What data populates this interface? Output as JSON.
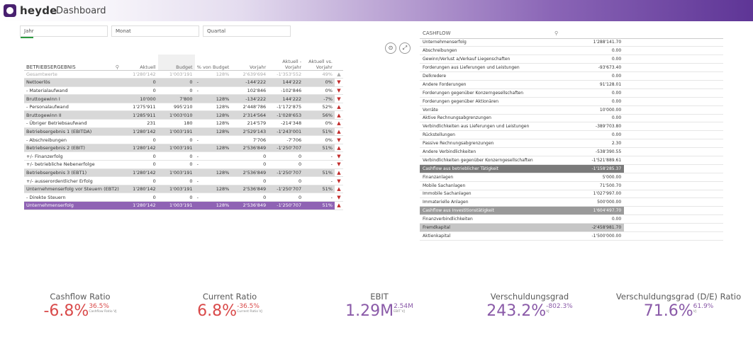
{
  "app": {
    "logo_text": "heyde",
    "title": "Dashboard"
  },
  "filters": [
    {
      "label": "Jahr"
    },
    {
      "label": "Monat"
    },
    {
      "label": "Quartal"
    }
  ],
  "left_table": {
    "columns": [
      "BETRIEBSERGEBNIS",
      "Aktuell",
      "Budget",
      "% von Budget",
      "Vorjahr",
      "Aktuell - Vorjahr",
      "Aktuell vs. Vorjahr"
    ],
    "total": {
      "label": "Gesamtwerte",
      "aktuell": "1'280'142",
      "budget": "1'003'191",
      "pct": "128%",
      "vorjahr": "2'639'694",
      "diff": "-1'353'552",
      "vs": "49%",
      "ind": "▲"
    },
    "rows": [
      {
        "label": "Nettoerlös",
        "aktuell": "0",
        "budget": "0",
        "pct": "-",
        "vorjahr": "-144'222",
        "diff": "144'222",
        "vs": "0%",
        "ind": "▼",
        "hl": true
      },
      {
        "label": "- Materialaufwand",
        "aktuell": "0",
        "budget": "0",
        "pct": "-",
        "vorjahr": "102'846",
        "diff": "-102'846",
        "vs": "0%",
        "ind": "▼",
        "hl": false
      },
      {
        "label": "Bruttogewinn I",
        "aktuell": "10'000",
        "budget": "7'800",
        "pct": "128%",
        "vorjahr": "-134'222",
        "diff": "144'222",
        "vs": "-7%",
        "ind": "▼",
        "hl": true
      },
      {
        "label": "- Personalaufwand",
        "aktuell": "1'275'911",
        "budget": "995'210",
        "pct": "128%",
        "vorjahr": "2'448'786",
        "diff": "-1'172'875",
        "vs": "52%",
        "ind": "▲",
        "hl": false
      },
      {
        "label": "Bruttogewinn II",
        "aktuell": "1'285'911",
        "budget": "1'003'010",
        "pct": "128%",
        "vorjahr": "2'314'564",
        "diff": "-1'028'653",
        "vs": "56%",
        "ind": "▲",
        "hl": true
      },
      {
        "label": "- Übriger Betriebsaufwand",
        "aktuell": "231",
        "budget": "180",
        "pct": "128%",
        "vorjahr": "214'579",
        "diff": "-214'348",
        "vs": "0%",
        "ind": "▲",
        "hl": false
      },
      {
        "label": "Betriebsergebnis 1 (EBITDA)",
        "aktuell": "1'280'142",
        "budget": "1'003'191",
        "pct": "128%",
        "vorjahr": "2'529'143",
        "diff": "-1'243'001",
        "vs": "51%",
        "ind": "▲",
        "hl": true
      },
      {
        "label": "- Abschreibungen",
        "aktuell": "0",
        "budget": "0",
        "pct": "-",
        "vorjahr": "7'706",
        "diff": "-7'706",
        "vs": "0%",
        "ind": "▼",
        "hl": false
      },
      {
        "label": "Betriebsergebnis 2 (EBIT)",
        "aktuell": "1'280'142",
        "budget": "1'003'191",
        "pct": "128%",
        "vorjahr": "2'536'849",
        "diff": "-1'250'707",
        "vs": "51%",
        "ind": "▲",
        "hl": true
      },
      {
        "label": "+/- Finanzerfolg",
        "aktuell": "0",
        "budget": "0",
        "pct": "-",
        "vorjahr": "0",
        "diff": "0",
        "vs": "-",
        "ind": "▼",
        "hl": false
      },
      {
        "label": "+/- betriebliche Nebenerfolge",
        "aktuell": "0",
        "budget": "0",
        "pct": "-",
        "vorjahr": "0",
        "diff": "0",
        "vs": "-",
        "ind": "▼",
        "hl": false
      },
      {
        "label": "Betriebsergebnis 3 (EBT1)",
        "aktuell": "1'280'142",
        "budget": "1'003'191",
        "pct": "128%",
        "vorjahr": "2'536'849",
        "diff": "-1'250'707",
        "vs": "51%",
        "ind": "▲",
        "hl": true
      },
      {
        "label": "+/- ausserordentlicher Erfolg",
        "aktuell": "0",
        "budget": "0",
        "pct": "-",
        "vorjahr": "0",
        "diff": "0",
        "vs": "-",
        "ind": "▼",
        "hl": false
      },
      {
        "label": "Unternehmenserfolg vor Steuern (EBT2)",
        "aktuell": "1'280'142",
        "budget": "1'003'191",
        "pct": "128%",
        "vorjahr": "2'536'849",
        "diff": "-1'250'707",
        "vs": "51%",
        "ind": "▲",
        "hl": true
      },
      {
        "label": "- Direkte Steuern",
        "aktuell": "0",
        "budget": "0",
        "pct": "-",
        "vorjahr": "0",
        "diff": "0",
        "vs": "-",
        "ind": "▼",
        "hl": false
      },
      {
        "label": "Unternehmenserfolg",
        "aktuell": "1'280'142",
        "budget": "1'003'191",
        "pct": "128%",
        "vorjahr": "2'536'849",
        "diff": "-1'250'707",
        "vs": "51%",
        "ind": "▲",
        "final": true
      }
    ]
  },
  "cashflow_table": {
    "header": "CASHFLOW",
    "rows": [
      {
        "label": "Unternehmenserfolg",
        "value": "1'288'141.70"
      },
      {
        "label": "Abschreibungen",
        "value": "0.00"
      },
      {
        "label": "Gewinn/Verlust a/Verkauf Liegenschaften",
        "value": "0.00"
      },
      {
        "label": "Forderungen aus Lieferungen und Leistungen",
        "value": "-93'673.40"
      },
      {
        "label": "Delkredere",
        "value": "0.00"
      },
      {
        "label": "Andere Forderungen",
        "value": "91'128.01"
      },
      {
        "label": "Forderungen gegenüber Konzerngesellschaften",
        "value": "0.00"
      },
      {
        "label": "Forderungen gegenüber Aktionären",
        "value": "0.00"
      },
      {
        "label": "Vorräte",
        "value": "10'000.00"
      },
      {
        "label": "Aktive Rechnungsabgrenzungen",
        "value": "0.00"
      },
      {
        "label": "Verbindlichkeiten aus Lieferungen und Leistungen",
        "value": "-389'703.80"
      },
      {
        "label": "Rückstellungen",
        "value": "0.00"
      },
      {
        "label": "Passive Rechnungsabgrenzungen",
        "value": "2.30"
      },
      {
        "label": "Andere Verbindlichkeiten",
        "value": "-538'390.55"
      },
      {
        "label": "Verbindlichkeiten gegenüber Konzerngesellschaften",
        "value": "-1'521'889.61"
      },
      {
        "label": "Cashflow aus betrieblicher Tätigkeit",
        "value": "-1'158'285.37",
        "style": "dark"
      },
      {
        "label": "Finanzanlagen",
        "value": "5'000.00"
      },
      {
        "label": "Mobile Sachanlagen",
        "value": "71'500.70"
      },
      {
        "label": "Immobile Sachanlagen",
        "value": "1'027'997.00"
      },
      {
        "label": "Immaterielle Anlagen",
        "value": "500'000.00"
      },
      {
        "label": "Cashflow aus Investitionstätigkeit",
        "value": "1'604'497.70",
        "style": "mid2"
      },
      {
        "label": "Finanzverbindlichkeiten",
        "value": "0.00"
      },
      {
        "label": "Fremdkapital",
        "value": "-2'458'981.70",
        "style": "mid"
      },
      {
        "label": "Aktienkapital",
        "value": "-1'500'000.00"
      }
    ]
  },
  "kpis": [
    {
      "title": "Cashflow Ratio",
      "value": "-6.8%",
      "compare": "36.5%",
      "caption": "Cashflow Ratio VJ",
      "color": "#d94a4a"
    },
    {
      "title": "Current Ratio",
      "value": "6.8%",
      "compare": "-36.5%",
      "caption": "Current Ratio VJ",
      "color": "#d94a4a"
    },
    {
      "title": "EBIT",
      "value": "1.29M",
      "compare": "2.54M",
      "caption": "EBIT VJ",
      "color": "#8a5aa8"
    },
    {
      "title": "Verschuldungsgrad",
      "value": "243.2%",
      "compare": "-802.3%",
      "caption": "VJ",
      "color": "#8a5aa8"
    },
    {
      "title": "Verschuldungsgrad (D/E) Ratio",
      "value": "71.6%",
      "compare": "61.9%",
      "caption": "VJ",
      "color": "#8a5aa8"
    }
  ],
  "icons": {
    "camera": "camera-icon",
    "expand": "expand-icon",
    "search": "search-icon"
  }
}
